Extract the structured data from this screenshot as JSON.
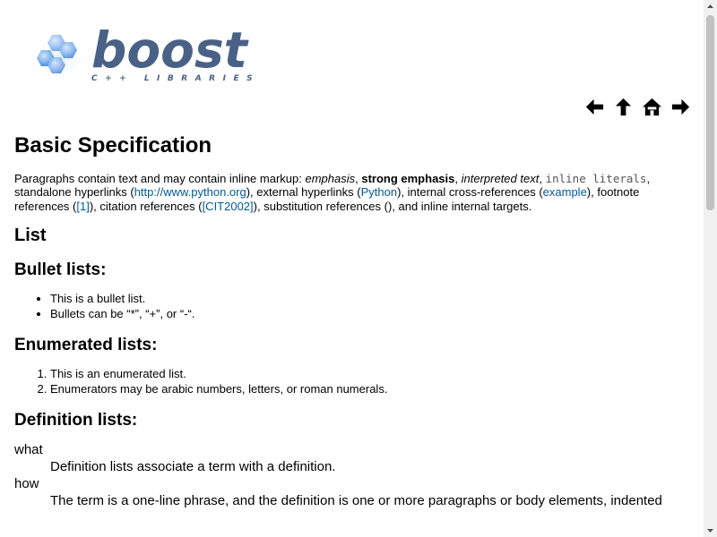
{
  "logo": {
    "word": "boost",
    "subtitle": "C++ LIBRARIES",
    "colors": {
      "hex_light": "#a8c8ee",
      "hex_dark": "#5d8fd6",
      "text": "#4a6187"
    }
  },
  "nav": {
    "prev_icon": "arrow-left-icon",
    "up_icon": "arrow-up-icon",
    "home_icon": "home-icon",
    "next_icon": "arrow-right-icon"
  },
  "page": {
    "title": "Basic Specification",
    "intro": {
      "t1": "Paragraphs contain text and may contain inline markup: ",
      "emphasis": "emphasis",
      "t2": ", ",
      "strong": "strong emphasis",
      "t3": ", ",
      "interpreted": "interpreted text",
      "t4": ", ",
      "literal": "inline literals",
      "t5": ", standalone hyperlinks (",
      "link_python_org": "http://www.python.org",
      "t6": "), external hyperlinks (",
      "link_python": "Python",
      "t7": "), internal cross-references (",
      "link_example": "example",
      "t8": "), footnote references (",
      "link_footnote": "[1]",
      "t9": "), citation references (",
      "link_citation": "[CIT2002]",
      "t10": "), substitution references (), and inline internal targets."
    }
  },
  "sections": {
    "list_heading": "List",
    "bullet_heading": "Bullet lists:",
    "bullet_items": [
      "This is a bullet list.",
      "Bullets can be “*”, “+”, or “-“."
    ],
    "enumerated_heading": "Enumerated lists:",
    "enumerated_items": [
      "This is an enumerated list.",
      "Enumerators may be arabic numbers, letters, or roman numerals."
    ],
    "definition_heading": "Definition lists:",
    "definitions": [
      {
        "term": "what",
        "definition": "Definition lists associate a term with a definition."
      },
      {
        "term": "how",
        "definition": "The term is a one-line phrase, and the definition is one or more paragraphs or body elements, indented"
      }
    ]
  }
}
